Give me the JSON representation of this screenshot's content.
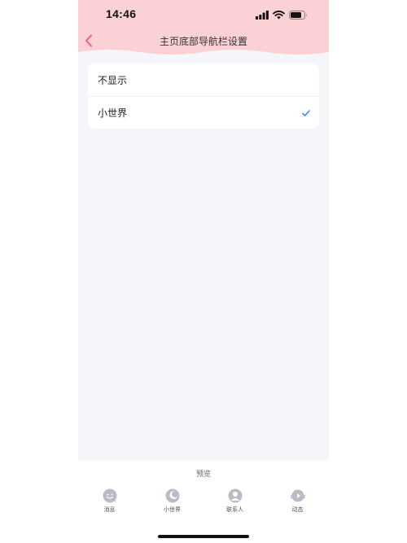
{
  "status_bar": {
    "time": "14:46"
  },
  "nav": {
    "title": "主页底部导航栏设置",
    "back_icon": "chevron-left-icon",
    "accent_color": "#e96b86",
    "header_color": "#fbd1d6"
  },
  "options": [
    {
      "label": "不显示",
      "selected": false
    },
    {
      "label": "小世界",
      "selected": true
    }
  ],
  "check_color": "#3a8fd8",
  "preview": {
    "label": "预览",
    "tabs": [
      {
        "label": "消息",
        "icon": "message-icon"
      },
      {
        "label": "小世界",
        "icon": "small-world-icon"
      },
      {
        "label": "联系人",
        "icon": "contacts-icon"
      },
      {
        "label": "动态",
        "icon": "feed-icon"
      }
    ]
  }
}
